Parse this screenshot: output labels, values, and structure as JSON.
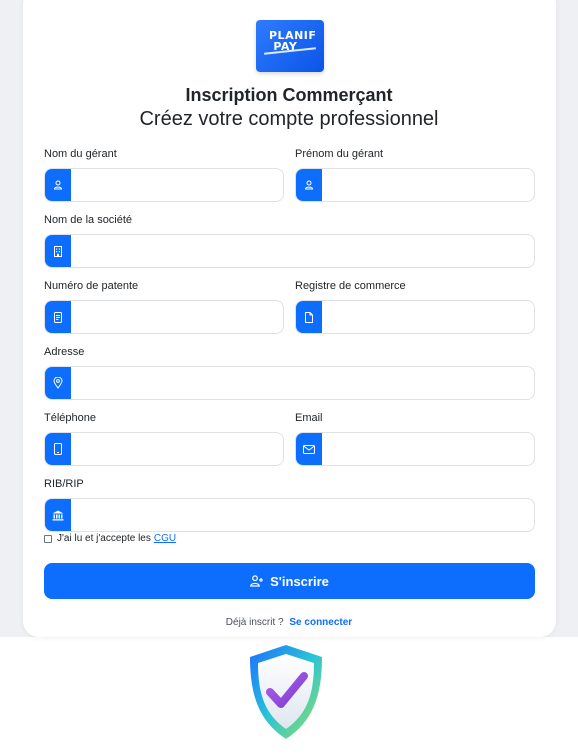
{
  "brand": {
    "logo_line1": "PLANIF",
    "logo_line2": "PAY"
  },
  "header": {
    "title": "Inscription Commerçant",
    "subtitle": "Créez votre compte professionnel"
  },
  "form": {
    "nom_gerant": {
      "label": "Nom du gérant",
      "value": "",
      "icon": "user-icon"
    },
    "prenom_gerant": {
      "label": "Prénom du gérant",
      "value": "",
      "icon": "user-icon"
    },
    "societe": {
      "label": "Nom de la société",
      "value": "",
      "icon": "building-icon"
    },
    "patente": {
      "label": "Numéro de patente",
      "value": "",
      "icon": "document-icon"
    },
    "registre": {
      "label": "Registre de commerce",
      "value": "",
      "icon": "file-icon"
    },
    "adresse": {
      "label": "Adresse",
      "value": "",
      "icon": "location-pin-icon"
    },
    "telephone": {
      "label": "Téléphone",
      "value": "",
      "icon": "phone-icon"
    },
    "email": {
      "label": "Email",
      "value": "",
      "icon": "envelope-icon"
    },
    "rib": {
      "label": "RIB/RIP",
      "value": "",
      "icon": "bank-icon"
    },
    "cgu_text": "J'ai lu et j'accepte les",
    "cgu_link": "CGU",
    "cgu_checked": false,
    "submit_label": "S'inscrire"
  },
  "footer": {
    "already_text": "Déjà inscrit ?",
    "login_link": "Se connecter"
  },
  "colors": {
    "primary": "#0d6efd",
    "background": "#eef0f4"
  }
}
